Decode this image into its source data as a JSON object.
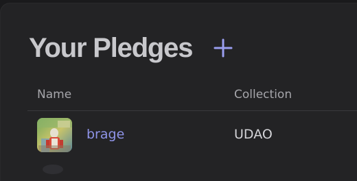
{
  "header": {
    "title": "Your Pledges",
    "add_icon": "plus-icon"
  },
  "table": {
    "columns": [
      "Name",
      "Collection"
    ],
    "rows": [
      {
        "name": "brage",
        "collection": "UDAO",
        "thumbnail": "nft-thumbnail-image"
      }
    ]
  },
  "colors": {
    "background": "#232325",
    "title": "#c8c8cc",
    "accent": "#8f94e8",
    "header_text": "#a6a6ab",
    "divider": "#3a3a3e"
  }
}
